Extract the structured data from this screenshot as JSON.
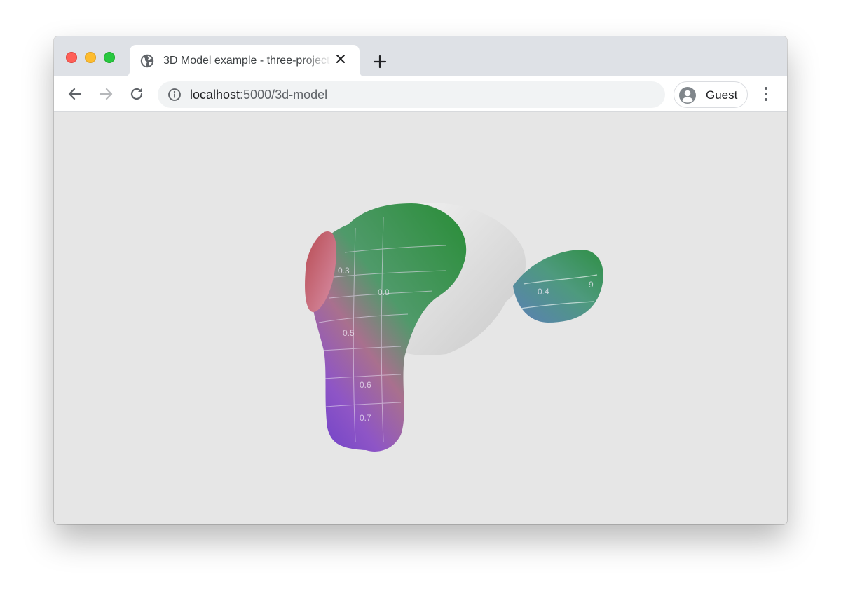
{
  "window": {
    "traffic_lights": {
      "close_color": "#ff5f57",
      "minimize_color": "#febc2e",
      "maximize_color": "#28c840"
    }
  },
  "tab": {
    "title": "3D Model example - three-project",
    "favicon": "globe-icon",
    "close_icon": "close-icon"
  },
  "toolbar": {
    "back_icon": "arrow-left-icon",
    "forward_icon": "arrow-right-icon",
    "reload_icon": "reload-icon",
    "info_icon": "info-icon",
    "url_host": "localhost",
    "url_path": ":5000/3d-model",
    "profile_label": "Guest",
    "profile_icon": "account-circle-icon",
    "menu_icon": "more-vertical-icon",
    "new_tab_icon": "plus-icon"
  },
  "content": {
    "background": "#e6e6e6",
    "model": {
      "name": "monkey-head-3d-model",
      "texture_labels": [
        "0.3",
        "0.5",
        "0.6",
        "0.7",
        "0.8",
        "0.4",
        "9"
      ]
    }
  }
}
